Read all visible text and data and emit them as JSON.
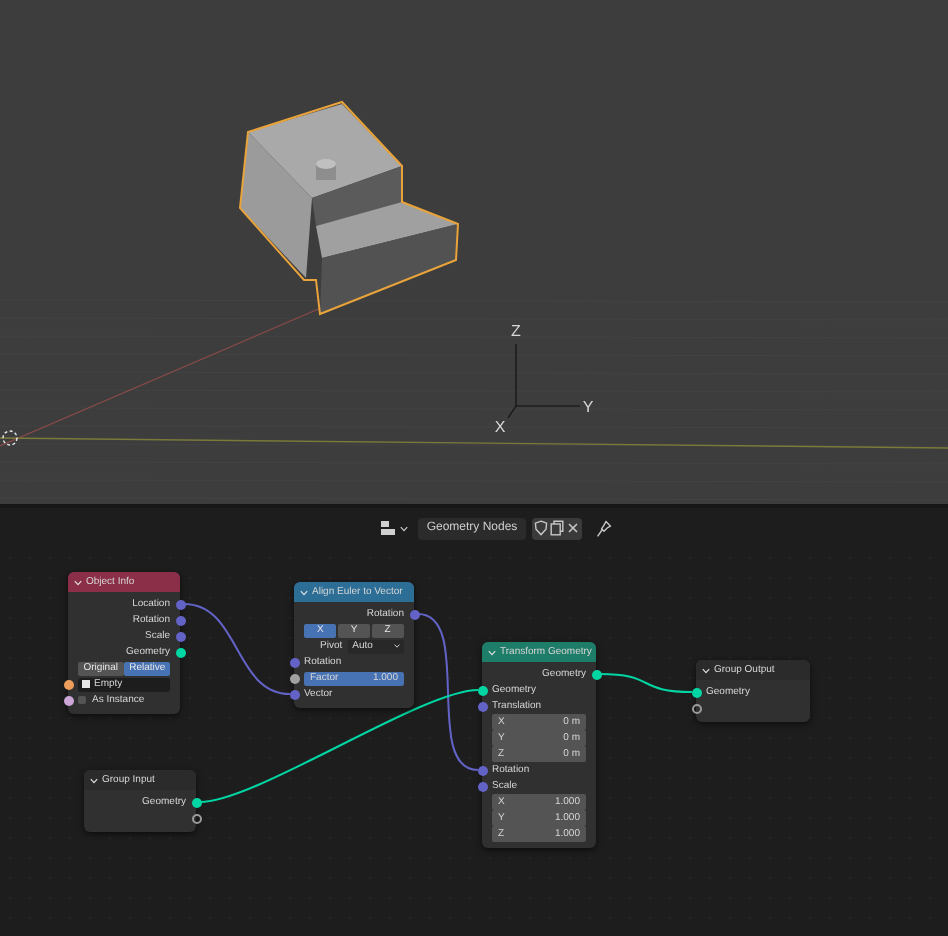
{
  "viewport": {
    "axis_labels": [
      "Z",
      "Y",
      "X"
    ]
  },
  "node_editor": {
    "header": {
      "tree_name": "Geometry Nodes"
    },
    "nodes": [
      {
        "title": "Object Info",
        "color": "#8a2f47",
        "rows": [
          {
            "kind": "output",
            "color": "#6363c7",
            "label": "Location"
          },
          {
            "kind": "output",
            "color": "#6363c7",
            "label": "Rotation"
          },
          {
            "kind": "output",
            "color": "#6363c7",
            "label": "Scale"
          },
          {
            "kind": "output",
            "color": "#00d6a3",
            "label": "Geometry"
          },
          {
            "kind": "toggle",
            "options": [
              {
                "label": "Original",
                "selected": false
              },
              {
                "label": "Relative",
                "selected": true
              }
            ]
          },
          {
            "kind": "object_field",
            "color": "#ed9e5c",
            "value": "Empty"
          },
          {
            "kind": "checkbox",
            "color": "#cca6d6",
            "label": "As Instance",
            "checked": false
          }
        ]
      },
      {
        "title": "Align Euler to Vector",
        "color": "#2c6e95",
        "rows": [
          {
            "kind": "output",
            "color": "#6363c7",
            "label": "Rotation"
          },
          {
            "kind": "axis_buttons",
            "options": [
              {
                "label": "X",
                "selected": true
              },
              {
                "label": "Y",
                "selected": false
              },
              {
                "label": "Z",
                "selected": false
              }
            ]
          },
          {
            "kind": "dropdown",
            "label": "Pivot",
            "value": "Auto"
          },
          {
            "kind": "input",
            "color": "#6363c7",
            "label": "Rotation"
          },
          {
            "kind": "slider",
            "color": "#a1a1a1",
            "label": "Factor",
            "value": "1.000",
            "level": 1
          },
          {
            "kind": "input",
            "color": "#6363c7",
            "label": "Vector"
          }
        ]
      },
      {
        "title": "Transform Geometry",
        "color": "#1d7d69",
        "rows": [
          {
            "kind": "output",
            "color": "#00d6a3",
            "label": "Geometry"
          },
          {
            "kind": "input",
            "color": "#00d6a3",
            "label": "Geometry"
          },
          {
            "kind": "input",
            "color": "#6363c7",
            "label": "Translation"
          },
          {
            "kind": "value",
            "label": "X",
            "value": "0 m"
          },
          {
            "kind": "value",
            "label": "Y",
            "value": "0 m"
          },
          {
            "kind": "value",
            "label": "Z",
            "value": "0 m"
          },
          {
            "kind": "input",
            "color": "#6363c7",
            "label": "Rotation"
          },
          {
            "kind": "input",
            "color": "#6363c7",
            "label": "Scale"
          },
          {
            "kind": "value",
            "label": "X",
            "value": "1.000"
          },
          {
            "kind": "value",
            "label": "Y",
            "value": "1.000"
          },
          {
            "kind": "value",
            "label": "Z",
            "value": "1.000"
          }
        ]
      },
      {
        "title": "Group Output",
        "color": "#2b2b2b",
        "rows": [
          {
            "kind": "input",
            "color": "#00d6a3",
            "label": "Geometry"
          },
          {
            "kind": "input"
          }
        ]
      },
      {
        "title": "Group Input",
        "color": "#2b2b2b",
        "rows": [
          {
            "kind": "output",
            "color": "#00d6a3",
            "label": "Geometry"
          },
          {
            "kind": "output"
          }
        ]
      }
    ]
  }
}
